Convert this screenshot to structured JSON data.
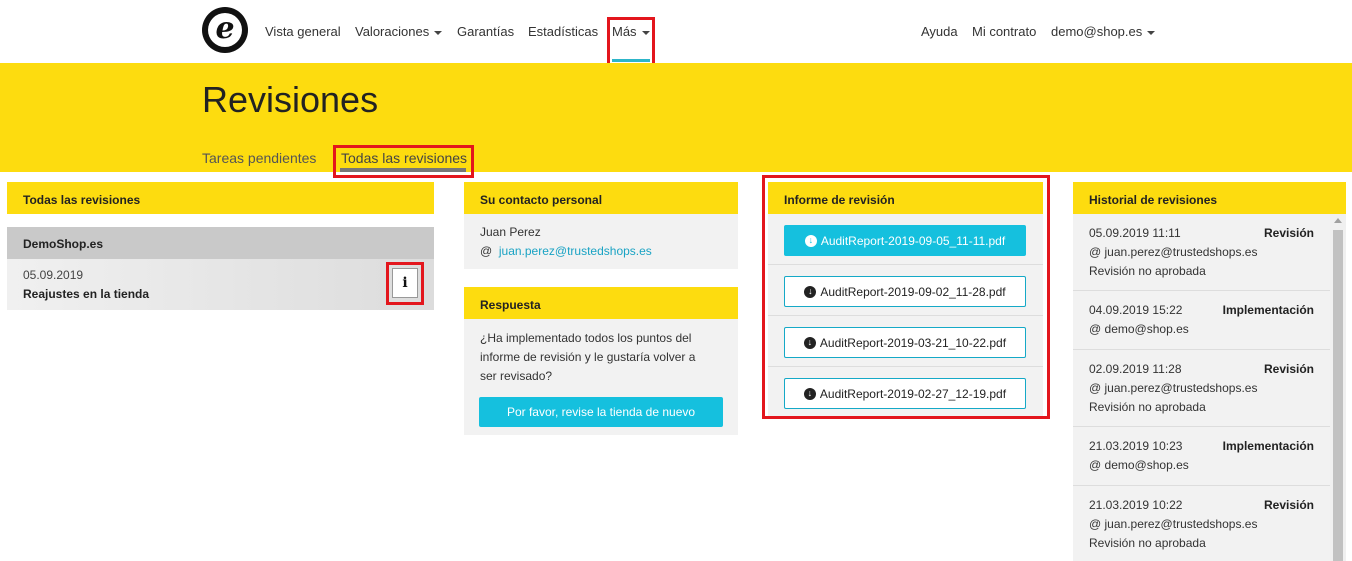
{
  "nav": {
    "logo_letter": "e",
    "items": [
      "Vista general",
      "Valoraciones",
      "Garantías",
      "Estadísticas",
      "Más"
    ],
    "right": [
      "Ayuda",
      "Mi contrato",
      "demo@shop.es"
    ]
  },
  "header": {
    "title": "Revisiones",
    "tabs": [
      "Tareas pendientes",
      "Todas las revisiones"
    ]
  },
  "all_reviews": {
    "title": "Todas las revisiones",
    "shop_name": "DemoShop.es",
    "date": "05.09.2019",
    "description": "Reajustes en la tienda",
    "info_label": "i"
  },
  "contact": {
    "title": "Su contacto personal",
    "name": "Juan Perez",
    "at": "@",
    "email": "juan.perez@trustedshops.es"
  },
  "response": {
    "title": "Respuesta",
    "text_lines": [
      "¿Ha implementado todos los puntos del",
      "informe de revisión y le gustaría volver a",
      "ser revisado?"
    ],
    "button": "Por favor, revise la tienda de nuevo"
  },
  "report": {
    "title": "Informe de revisión",
    "files": [
      "AuditReport-2019-09-05_11-11.pdf",
      "AuditReport-2019-09-02_11-28.pdf",
      "AuditReport-2019-03-21_10-22.pdf",
      "AuditReport-2019-02-27_12-19.pdf"
    ]
  },
  "history": {
    "title": "Historial de revisiones",
    "entries": [
      {
        "date": "05.09.2019 11:11",
        "type": "Revisión",
        "user": "@ juan.perez@trustedshops.es",
        "status": "Revisión no aprobada"
      },
      {
        "date": "04.09.2019 15:22",
        "type": "Implementación",
        "user": "@ demo@shop.es",
        "status": ""
      },
      {
        "date": "02.09.2019 11:28",
        "type": "Revisión",
        "user": "@ juan.perez@trustedshops.es",
        "status": "Revisión no aprobada"
      },
      {
        "date": "21.03.2019 10:23",
        "type": "Implementación",
        "user": "@ demo@shop.es",
        "status": ""
      },
      {
        "date": "21.03.2019 10:22",
        "type": "Revisión",
        "user": "@ juan.perez@trustedshops.es",
        "status": "Revisión no aprobada"
      }
    ]
  },
  "colors": {
    "accent_yellow": "#fddc0f",
    "accent_cyan": "#15c0de",
    "highlight_red": "#e3161d"
  }
}
